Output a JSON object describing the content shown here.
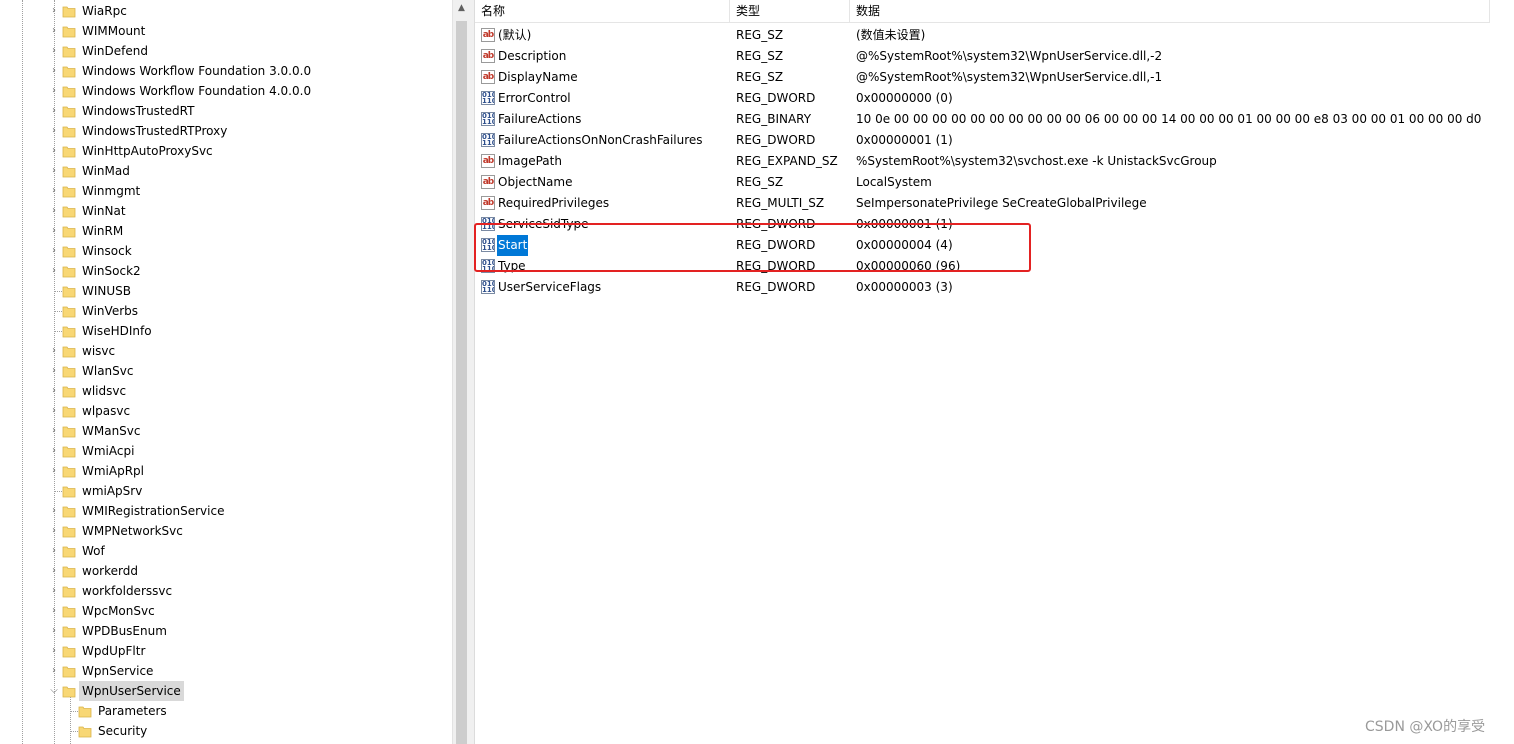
{
  "tree": {
    "items": [
      {
        "label": "WiaRpc",
        "expander": true
      },
      {
        "label": "WIMMount",
        "expander": true
      },
      {
        "label": "WinDefend",
        "expander": true
      },
      {
        "label": "Windows Workflow Foundation 3.0.0.0",
        "expander": true
      },
      {
        "label": "Windows Workflow Foundation 4.0.0.0",
        "expander": true
      },
      {
        "label": "WindowsTrustedRT",
        "expander": true
      },
      {
        "label": "WindowsTrustedRTProxy",
        "expander": true
      },
      {
        "label": "WinHttpAutoProxySvc",
        "expander": true
      },
      {
        "label": "WinMad",
        "expander": true
      },
      {
        "label": "Winmgmt",
        "expander": true
      },
      {
        "label": "WinNat",
        "expander": true
      },
      {
        "label": "WinRM",
        "expander": true
      },
      {
        "label": "Winsock",
        "expander": true
      },
      {
        "label": "WinSock2",
        "expander": true
      },
      {
        "label": "WINUSB",
        "expander": false
      },
      {
        "label": "WinVerbs",
        "expander": false
      },
      {
        "label": "WiseHDInfo",
        "expander": false
      },
      {
        "label": "wisvc",
        "expander": true
      },
      {
        "label": "WlanSvc",
        "expander": true
      },
      {
        "label": "wlidsvc",
        "expander": true
      },
      {
        "label": "wlpasvc",
        "expander": true
      },
      {
        "label": "WManSvc",
        "expander": true
      },
      {
        "label": "WmiAcpi",
        "expander": true
      },
      {
        "label": "WmiApRpl",
        "expander": true
      },
      {
        "label": "wmiApSrv",
        "expander": false
      },
      {
        "label": "WMIRegistrationService",
        "expander": true
      },
      {
        "label": "WMPNetworkSvc",
        "expander": true
      },
      {
        "label": "Wof",
        "expander": true
      },
      {
        "label": "workerdd",
        "expander": true
      },
      {
        "label": "workfolderssvc",
        "expander": true
      },
      {
        "label": "WpcMonSvc",
        "expander": true
      },
      {
        "label": "WPDBusEnum",
        "expander": true
      },
      {
        "label": "WpdUpFltr",
        "expander": true
      },
      {
        "label": "WpnService",
        "expander": true
      },
      {
        "label": "WpnUserService",
        "expander": "open",
        "selected": true
      }
    ],
    "children": [
      {
        "label": "Parameters"
      },
      {
        "label": "Security"
      }
    ]
  },
  "list": {
    "columns": {
      "name": "名称",
      "type": "类型",
      "data": "数据"
    },
    "rows": [
      {
        "icon": "string-value-icon",
        "name": "(默认)",
        "type": "REG_SZ",
        "data": "(数值未设置)"
      },
      {
        "icon": "string-value-icon",
        "name": "Description",
        "type": "REG_SZ",
        "data": "@%SystemRoot%\\system32\\WpnUserService.dll,-2"
      },
      {
        "icon": "string-value-icon",
        "name": "DisplayName",
        "type": "REG_SZ",
        "data": "@%SystemRoot%\\system32\\WpnUserService.dll,-1"
      },
      {
        "icon": "binary-value-icon",
        "name": "ErrorControl",
        "type": "REG_DWORD",
        "data": "0x00000000 (0)"
      },
      {
        "icon": "binary-value-icon",
        "name": "FailureActions",
        "type": "REG_BINARY",
        "data": "10 0e 00 00 00 00 00 00 00 00 00 00 06 00 00 00 14 00 00 00 01 00 00 00 e8 03 00 00 01 00 00 00 d0 07 0..."
      },
      {
        "icon": "binary-value-icon",
        "name": "FailureActionsOnNonCrashFailures",
        "type": "REG_DWORD",
        "data": "0x00000001 (1)"
      },
      {
        "icon": "string-value-icon",
        "name": "ImagePath",
        "type": "REG_EXPAND_SZ",
        "data": "%SystemRoot%\\system32\\svchost.exe -k UnistackSvcGroup"
      },
      {
        "icon": "string-value-icon",
        "name": "ObjectName",
        "type": "REG_SZ",
        "data": "LocalSystem"
      },
      {
        "icon": "string-value-icon",
        "name": "RequiredPrivileges",
        "type": "REG_MULTI_SZ",
        "data": "SeImpersonatePrivilege SeCreateGlobalPrivilege"
      },
      {
        "icon": "binary-value-icon",
        "name": "ServiceSidType",
        "type": "REG_DWORD",
        "data": "0x00000001 (1)"
      },
      {
        "icon": "binary-value-icon",
        "name": "Start",
        "type": "REG_DWORD",
        "data": "0x00000004 (4)",
        "selected": true
      },
      {
        "icon": "binary-value-icon",
        "name": "Type",
        "type": "REG_DWORD",
        "data": "0x00000060 (96)"
      },
      {
        "icon": "binary-value-icon",
        "name": "UserServiceFlags",
        "type": "REG_DWORD",
        "data": "0x00000003 (3)"
      }
    ]
  },
  "icons": {
    "folder": "folder-icon",
    "expand": "chevron-right-icon",
    "collapse": "chevron-down-icon"
  },
  "colors": {
    "selection": "#0078d7",
    "folder": "#f8d775",
    "highlight_box": "#e32222"
  },
  "watermark": "CSDN @XO的享受"
}
